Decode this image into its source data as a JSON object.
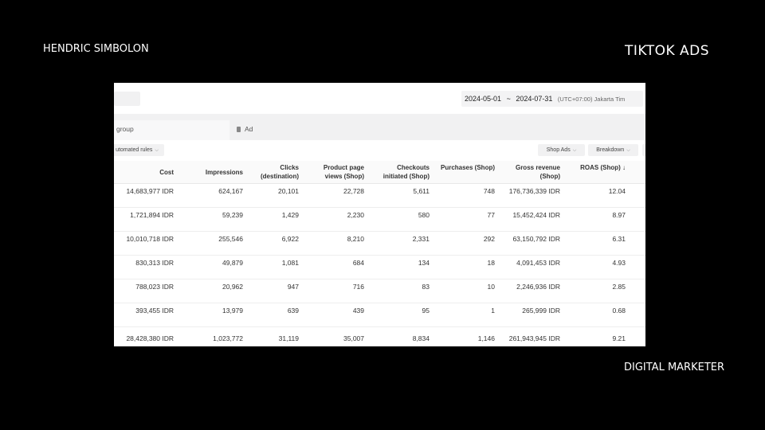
{
  "overlay": {
    "author": "HENDRIC SIMBOLON",
    "topic": "TIKTOK ADS",
    "role": "DIGITAL MARKETER"
  },
  "header": {
    "date_start": "2024-05-01",
    "date_sep": "~",
    "date_end": "2024-07-31",
    "timezone": "(UTC+07:00) Jakarta Tim"
  },
  "tabs": [
    {
      "label": "group"
    },
    {
      "label": "Ad",
      "icon": "ad-icon"
    }
  ],
  "toolbar": {
    "automated_rules": "utomated rules",
    "shop_ads": "Shop Ads",
    "breakdown": "Breakdown"
  },
  "columns": [
    "Cost",
    "Impressions",
    "Clicks (destination)",
    "Product page views (Shop)",
    "Checkouts initiated (Shop)",
    "Purchases (Shop)",
    "Gross revenue (Shop)",
    "ROAS (Shop) ↓"
  ],
  "rows": [
    [
      "14,683,977 IDR",
      "624,167",
      "20,101",
      "22,728",
      "5,611",
      "748",
      "176,736,339 IDR",
      "12.04"
    ],
    [
      "1,721,894 IDR",
      "59,239",
      "1,429",
      "2,230",
      "580",
      "77",
      "15,452,424 IDR",
      "8.97"
    ],
    [
      "10,010,718 IDR",
      "255,546",
      "6,922",
      "8,210",
      "2,331",
      "292",
      "63,150,792 IDR",
      "6.31"
    ],
    [
      "830,313 IDR",
      "49,879",
      "1,081",
      "684",
      "134",
      "18",
      "4,091,453 IDR",
      "4.93"
    ],
    [
      "788,023 IDR",
      "20,962",
      "947",
      "716",
      "83",
      "10",
      "2,246,936 IDR",
      "2.85"
    ],
    [
      "393,455 IDR",
      "13,979",
      "639",
      "439",
      "95",
      "1",
      "265,999 IDR",
      "0.68"
    ]
  ],
  "total": [
    "28,428,380 IDR",
    "1,023,772",
    "31,119",
    "35,007",
    "8,834",
    "1,146",
    "261,943,945 IDR",
    "9.21"
  ]
}
